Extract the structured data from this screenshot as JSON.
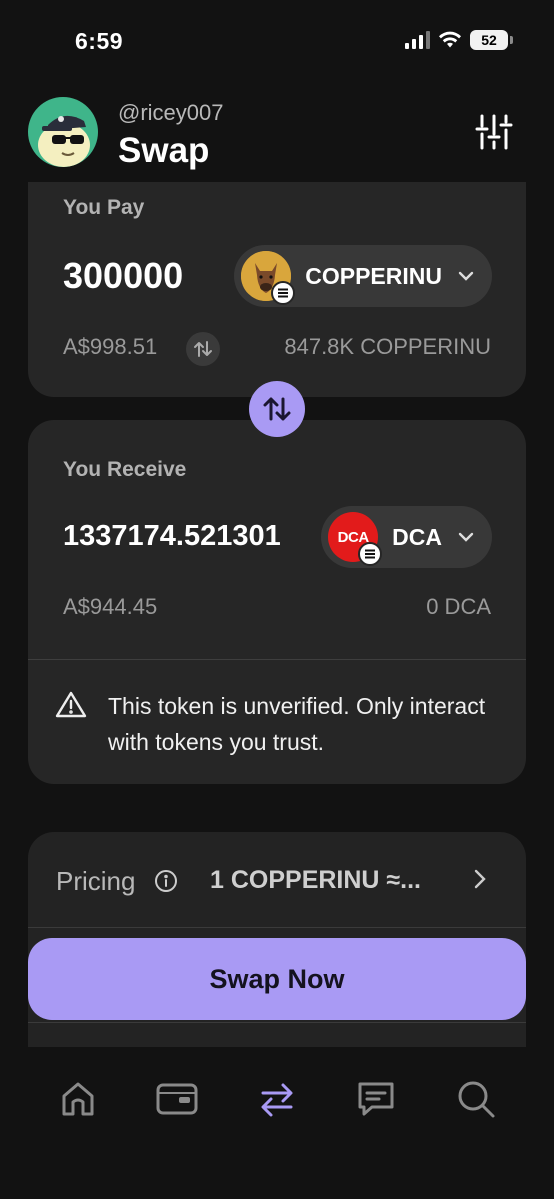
{
  "status_bar": {
    "time": "6:59",
    "battery": "52"
  },
  "header": {
    "username": "@ricey007",
    "title": "Swap"
  },
  "pay": {
    "label": "You Pay",
    "amount": "300000",
    "token": "COPPERINU",
    "fiat_value": "A$998.51",
    "balance": "847.8K COPPERINU"
  },
  "receive": {
    "label": "You Receive",
    "amount": "1337174.521301",
    "token": "DCA",
    "token_logo_text": "DCA",
    "fiat_value": "A$944.45",
    "balance": "0 DCA"
  },
  "warning": {
    "text": "This token is unverified. Only interact with tokens you trust."
  },
  "pricing": {
    "label": "Pricing",
    "value": "1 COPPERINU ≈..."
  },
  "action": {
    "swap_label": "Swap Now"
  },
  "nav": [
    "home-icon",
    "wallet-icon",
    "swap-icon",
    "chat-icon",
    "search-icon"
  ],
  "colors": {
    "accent": "#a99af4",
    "card": "#262626",
    "background": "#121212"
  }
}
